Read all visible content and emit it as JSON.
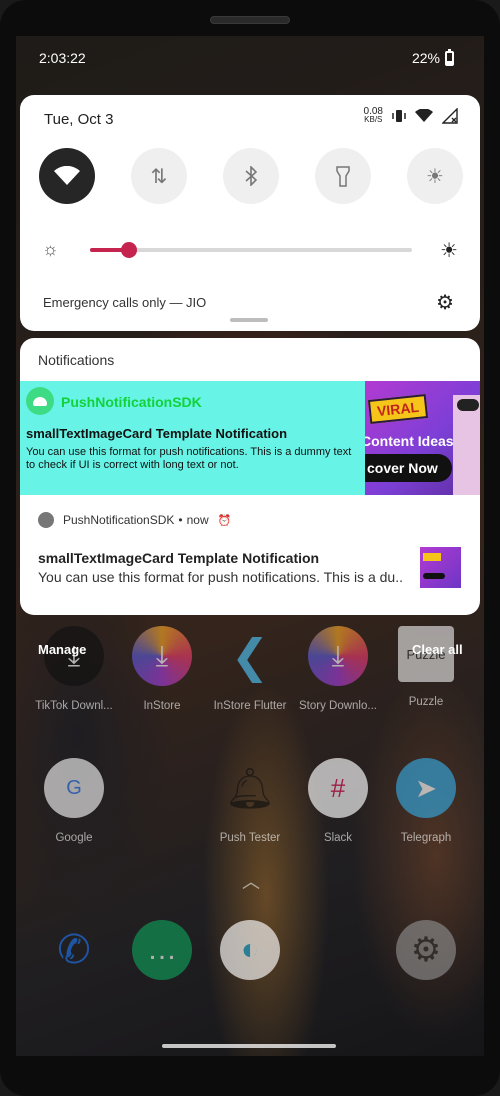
{
  "status_bar": {
    "time": "2:03:22",
    "battery": "22%"
  },
  "quick_settings": {
    "date": "Tue, Oct 3",
    "net_speed": {
      "value": "0.08",
      "unit": "KB/S"
    },
    "tiles": [
      {
        "name": "wifi",
        "icon": "wifi-icon",
        "active": true
      },
      {
        "name": "mobile-data",
        "icon": "data-arrows-icon",
        "active": false
      },
      {
        "name": "bluetooth",
        "icon": "bluetooth-icon",
        "active": false
      },
      {
        "name": "flashlight",
        "icon": "flashlight-icon",
        "active": false
      },
      {
        "name": "night-light",
        "icon": "night-light-icon",
        "active": false
      },
      {
        "name": "auto-rotate",
        "icon": "rotate-icon",
        "active": false
      }
    ],
    "brightness_fraction": 0.12,
    "carrier": "Emergency calls only — JIO"
  },
  "notifications": {
    "header": "Notifications",
    "custom_card": {
      "app_name": "PushNotificationSDK",
      "title": "smallTextImageCard Template Notification",
      "body": "You can use this format for push notifications. This is a dummy text to check if UI is correct with long text or not.",
      "image_text": {
        "burst": "VIRAL",
        "ideas": "Content Ideas",
        "button": "cover Now"
      }
    },
    "standard": {
      "app_name": "PushNotificationSDK",
      "separator": "•",
      "time": "now",
      "title": "smallTextImageCard Template Notification",
      "body": "You can use this format for push notifications. This is a du.."
    }
  },
  "actions": {
    "manage": "Manage",
    "clear_all": "Clear all"
  },
  "launcher": {
    "row1": [
      "TikTok Downl...",
      "InStore",
      "InStore Flutter",
      "Story Downlo...",
      "Puzzle"
    ],
    "puzzle_icon_text": "Puzzle",
    "row2": [
      "Google",
      "Push Tester",
      "Slack",
      "Telegraph"
    ]
  },
  "colors": {
    "accent": "#c4244d",
    "card_bg": "#67f4e6",
    "app_name_green": "#12d23a"
  }
}
